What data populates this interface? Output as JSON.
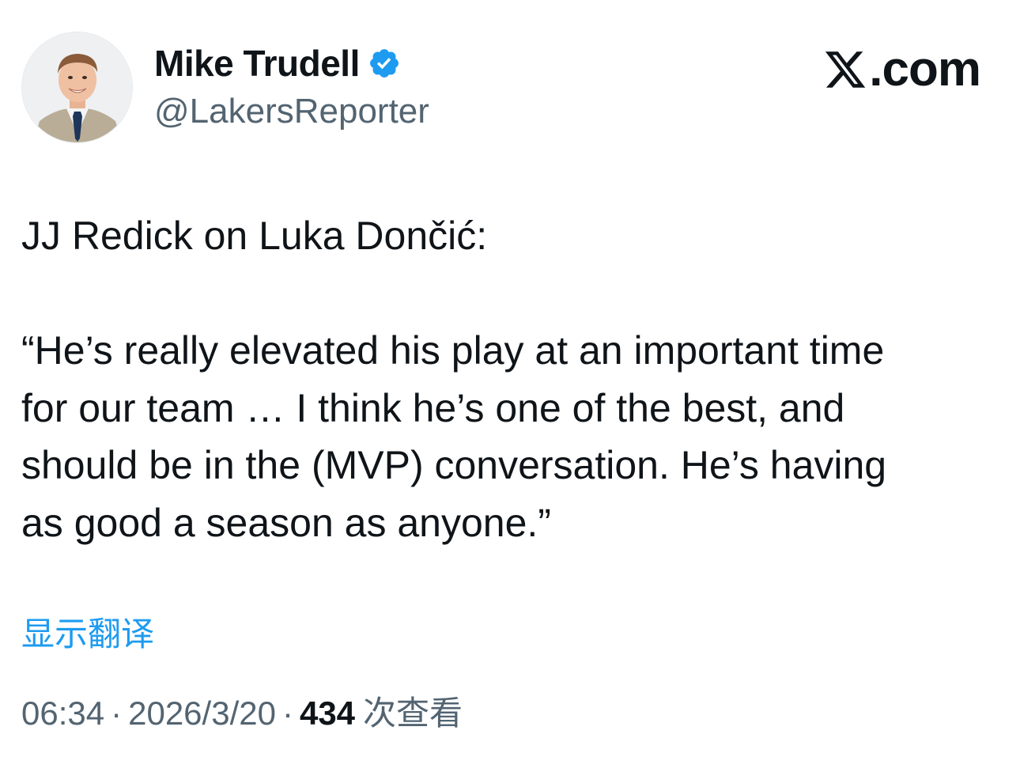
{
  "author": {
    "display_name": "Mike Trudell",
    "handle": "@LakersReporter",
    "verified_color": "#1d9bf0"
  },
  "brand": {
    "label": ".com",
    "icon": "x-logo-icon"
  },
  "tweet": {
    "lines": [
      "JJ Redick on Luka Dončić:",
      "“He’s really elevated his play at an important time",
      "for our team … I think he’s one of the best, and",
      "should be in the (MVP) conversation. He’s having",
      "as good a season as anyone.”"
    ]
  },
  "translate_label": "显示翻译",
  "meta": {
    "time": "06:34",
    "separator": "·",
    "date": "2026/3/20",
    "views_count": "434",
    "views_label": "次查看"
  },
  "colors": {
    "link": "#1d9bf0",
    "secondary_text": "#536471",
    "primary_text": "#0f1419"
  }
}
